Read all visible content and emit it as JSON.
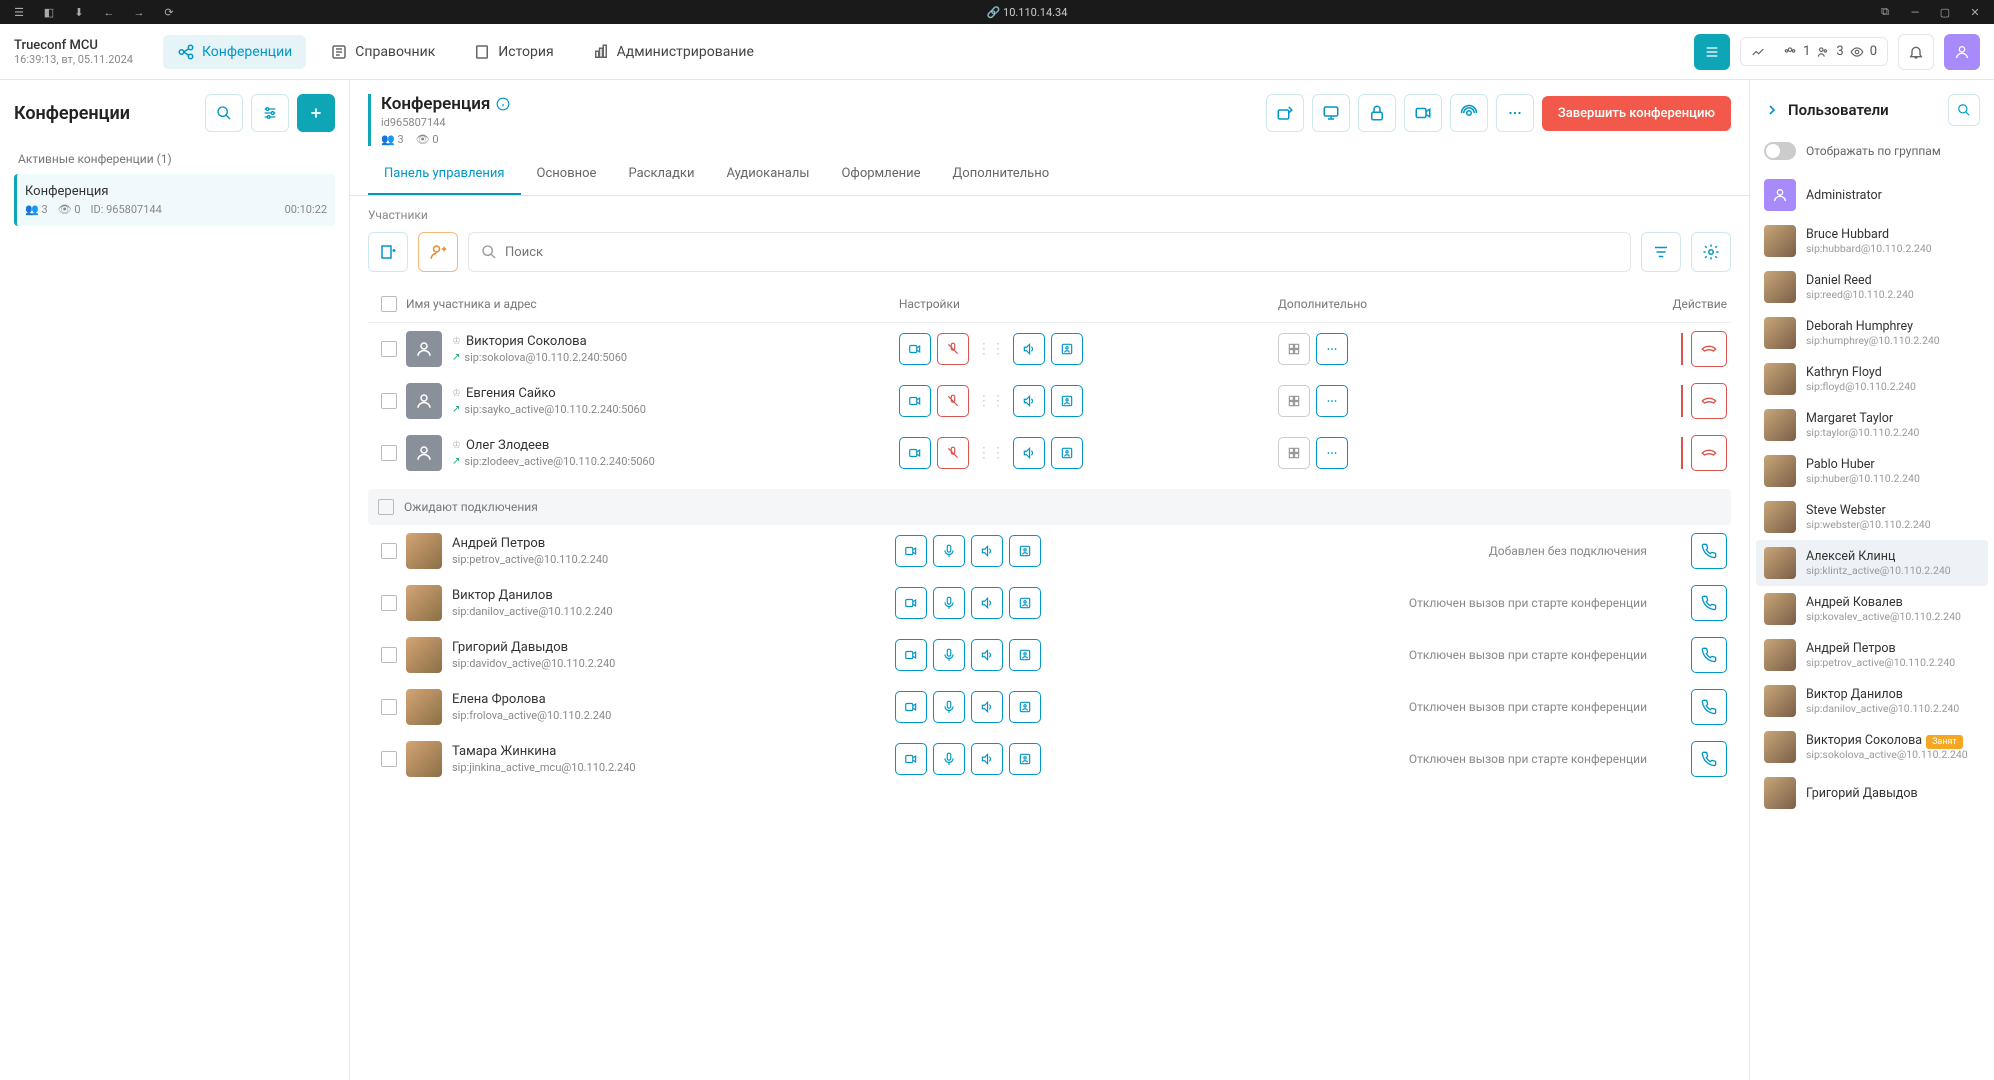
{
  "browser": {
    "address": "10.110.14.34"
  },
  "brand": {
    "name": "Trueconf MCU",
    "datetime": "16:39:13, вт, 05.11.2024"
  },
  "nav": {
    "conferences": "Конференции",
    "directory": "Справочник",
    "history": "История",
    "admin": "Администрирование"
  },
  "headerStats": {
    "groups": "1",
    "users": "3",
    "viewers": "0"
  },
  "leftPane": {
    "title": "Конференции",
    "activeLabel": "Активные конференции (1)",
    "item": {
      "name": "Конференция",
      "participants": "3",
      "viewers": "0",
      "id": "ID: 965807144",
      "duration": "00:10:22"
    }
  },
  "conf": {
    "name": "Конференция",
    "id": "id965807144",
    "participants": "3",
    "viewers": "0",
    "endBtn": "Завершить конференцию",
    "tabs": {
      "control": "Панель управления",
      "main": "Основное",
      "layouts": "Раскладки",
      "audio": "Аудиоканалы",
      "design": "Оформление",
      "extra": "Дополнительно"
    },
    "participantsLabel": "Участники",
    "searchPlaceholder": "Поиск",
    "columns": {
      "name": "Имя участника и адрес",
      "settings": "Настройки",
      "extra": "Дополнительно",
      "action": "Действие"
    },
    "active": [
      {
        "name": "Виктория Соколова",
        "addr": "sip:sokolova@10.110.2.240:5060"
      },
      {
        "name": "Евгения Сайко",
        "addr": "sip:sayko_active@10.110.2.240:5060"
      },
      {
        "name": "Олег Злодеев",
        "addr": "sip:zlodeev_active@10.110.2.240:5060"
      }
    ],
    "waitingLabel": "Ожидают подключения",
    "statusAdded": "Добавлен без подключения",
    "statusRejected": "Отключен вызов при старте конференции",
    "waiting": [
      {
        "name": "Андрей Петров",
        "addr": "sip:petrov_active@10.110.2.240"
      },
      {
        "name": "Виктор Данилов",
        "addr": "sip:danilov_active@10.110.2.240"
      },
      {
        "name": "Григорий Давыдов",
        "addr": "sip:davidov_active@10.110.2.240"
      },
      {
        "name": "Елена Фролова",
        "addr": "sip:frolova_active@10.110.2.240"
      },
      {
        "name": "Тамара Жинкина",
        "addr": "sip:jinkina_active_mcu@10.110.2.240"
      }
    ]
  },
  "rightPane": {
    "title": "Пользователи",
    "groupToggle": "Отображать по группам",
    "admin": "Administrator",
    "busyBadge": "Занят",
    "users": [
      {
        "name": "Bruce Hubbard",
        "addr": "sip:hubbard@10.110.2.240"
      },
      {
        "name": "Daniel Reed",
        "addr": "sip:reed@10.110.2.240"
      },
      {
        "name": "Deborah Humphrey",
        "addr": "sip:humphrey@10.110.2.240"
      },
      {
        "name": "Kathryn Floyd",
        "addr": "sip:floyd@10.110.2.240"
      },
      {
        "name": "Margaret Taylor",
        "addr": "sip:taylor@10.110.2.240"
      },
      {
        "name": "Pablo Huber",
        "addr": "sip:huber@10.110.2.240"
      },
      {
        "name": "Steve Webster",
        "addr": "sip:webster@10.110.2.240"
      },
      {
        "name": "Алексей Клинц",
        "addr": "sip:klintz_active@10.110.2.240"
      },
      {
        "name": "Андрей Ковалев",
        "addr": "sip:kovalev_active@10.110.2.240"
      },
      {
        "name": "Андрей Петров",
        "addr": "sip:petrov_active@10.110.2.240"
      },
      {
        "name": "Виктор Данилов",
        "addr": "sip:danilov_active@10.110.2.240"
      },
      {
        "name": "Виктория Соколова",
        "addr": "sip:sokolova_active@10.110.2.240",
        "busy": true
      },
      {
        "name": "Григорий Давыдов",
        "addr": ""
      }
    ]
  }
}
